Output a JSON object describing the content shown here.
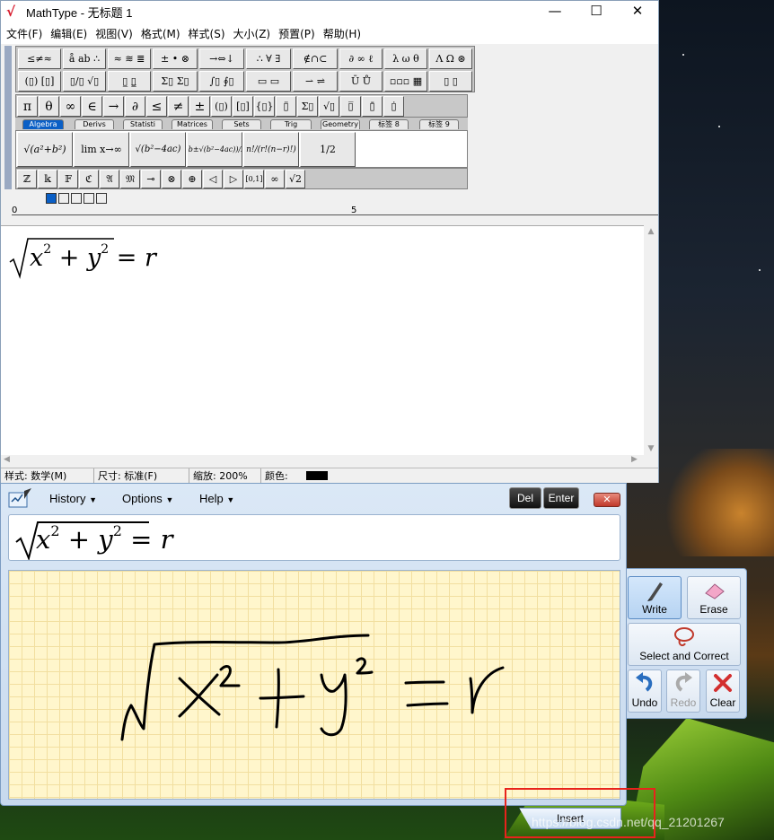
{
  "window": {
    "title": "MathType - 无标题 1",
    "minimize": "—",
    "maximize": "☐",
    "close": "✕"
  },
  "menu": [
    "文件(F)",
    "编辑(E)",
    "视图(V)",
    "格式(M)",
    "样式(S)",
    "大小(Z)",
    "预置(P)",
    "帮助(H)"
  ],
  "palette_row1": [
    "≤≠≈",
    "å ab ∴",
    "≈ ≋ ≣",
    "± • ⊗",
    "→⇔↓",
    "∴ ∀ ∃",
    "∉∩⊂",
    "∂ ∞ ℓ",
    "λ ω θ",
    "Λ Ω ⊛"
  ],
  "palette_row2": [
    "(▯) [▯]",
    "▯/▯ √▯",
    "▯̲ ▯̳",
    "Σ▯ Σ▯",
    "∫▯ ∮▯",
    "▭ ▭",
    "⇀ ⇌",
    "Ū Ů",
    "▫▫▫ ▦",
    "▯ ▯"
  ],
  "palette_row3": [
    "π",
    "θ",
    "∞",
    "∈",
    "→",
    "∂",
    "≤",
    "≠",
    "±",
    "(▯)",
    "[▯]",
    "{▯}",
    "▯̈",
    "Σ▯",
    "√▯",
    "▯̅",
    "▯̄",
    "▯̇"
  ],
  "tabs": [
    "Algebra",
    "Derivs",
    "Statisti",
    "Matrices",
    "Sets",
    "Trig",
    "Geometry",
    "标签 8",
    "标签 9"
  ],
  "templates": [
    "√(a²+b²)",
    "lim x→∞",
    "√(b²−4ac)",
    "(−b±√(b²−4ac))/2a",
    "n!/(r!(n−r)!)",
    "1/2"
  ],
  "palette_bottom": [
    "ℤ",
    "𝕜",
    "𝔽",
    "ℭ",
    "𝔄",
    "𝔐",
    "⊸",
    "⊗",
    "⊕",
    "◁",
    "▷",
    "[0,1]",
    "∞",
    "√2"
  ],
  "ruler": {
    "mark0": "0",
    "mark5": "5"
  },
  "equation": {
    "radicand_x": "x",
    "exp": "2",
    "plus": "+",
    "radicand_y": "y",
    "equals": "=",
    "rhs": "r"
  },
  "status": {
    "style": "样式: 数学(M)",
    "size": "尺寸: 标准(F)",
    "zoom": "缩放: 200%",
    "color": "颜色:"
  },
  "mip": {
    "menus": [
      "History",
      "Options",
      "Help"
    ],
    "del": "Del",
    "enter": "Enter",
    "close": "✕",
    "tools": {
      "write": "Write",
      "erase": "Erase",
      "select": "Select and Correct",
      "undo": "Undo",
      "redo": "Redo",
      "clear": "Clear"
    },
    "insert": "Insert"
  },
  "watermark": "https://blog.csdn.net/qq_21201267"
}
